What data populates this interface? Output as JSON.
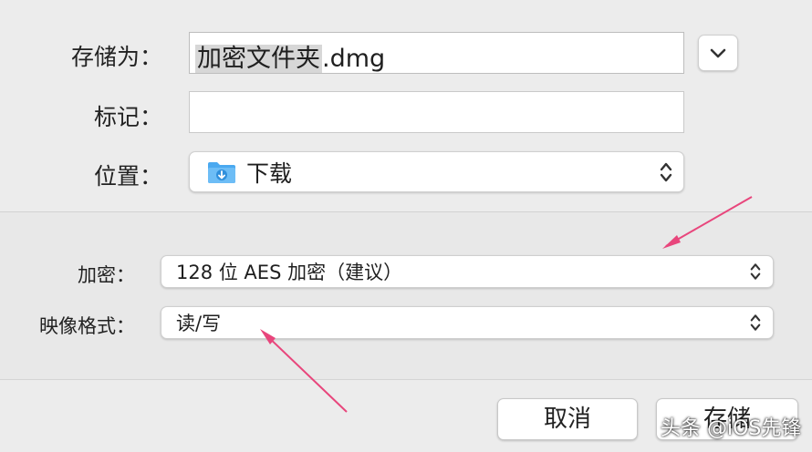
{
  "save_as": {
    "label": "存储为：",
    "value_selected": "加密文件夹",
    "value_ext": ".dmg"
  },
  "tags": {
    "label": "标记：",
    "value": ""
  },
  "where": {
    "label": "位置：",
    "value": "下载",
    "icon": "downloads-folder-icon"
  },
  "encryption": {
    "label": "加密：",
    "value": "128 位 AES 加密（建议）"
  },
  "image_format": {
    "label": "映像格式：",
    "value": "读/写"
  },
  "buttons": {
    "cancel": "取消",
    "save": "存储"
  },
  "watermark": "头条 @iOS先锋",
  "colors": {
    "arrow": "#e8467c",
    "selection": "#d7d7d7",
    "folder": "#4aa9f0"
  }
}
